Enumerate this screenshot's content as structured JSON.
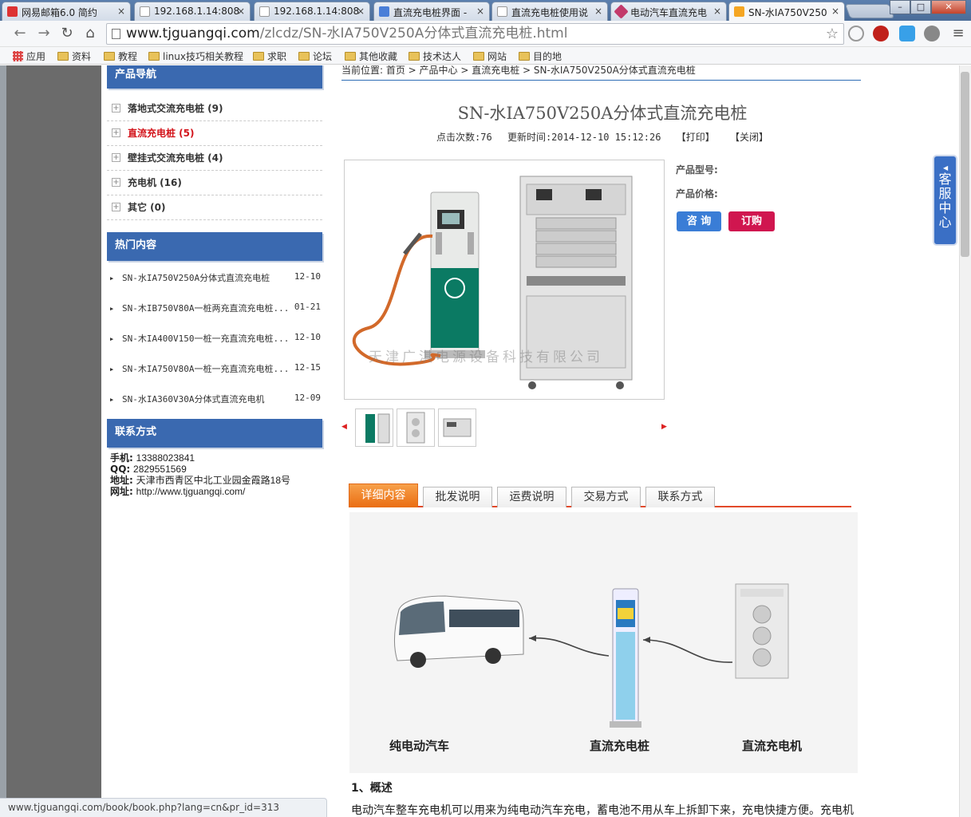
{
  "browser": {
    "tabs": [
      {
        "label": "网易邮箱6.0 简约",
        "icon_color": "#d33"
      },
      {
        "label": "192.168.1.14:808",
        "icon_color": "#ccc"
      },
      {
        "label": "192.168.1.14:808",
        "icon_color": "#ccc"
      },
      {
        "label": "直流充电桩界面 -",
        "icon_color": "#4a7fd8"
      },
      {
        "label": "直流充电桩使用说",
        "icon_color": "#ccc"
      },
      {
        "label": "电动汽车直流充电",
        "icon_color": "#c23a6b"
      },
      {
        "label": "SN-水IA750V250",
        "icon_color": "#f5a623"
      }
    ],
    "close_glyph": "×",
    "window_controls": {
      "minimize": "–",
      "maximize": "□",
      "close": "✕"
    },
    "url_host": "www.tjguangqi.com",
    "url_path": "/zlcdz/SN-水IA750V250A分体式直流充电桩.html",
    "bookmarks": [
      "应用",
      "资料",
      "教程",
      "linux技巧相关教程",
      "求职",
      "论坛",
      "其他收藏",
      "技术达人",
      "网站",
      "目的地"
    ],
    "status_url": "www.tjguangqi.com/book/book.php?lang=cn&pr_id=313"
  },
  "sidebar": {
    "nav_title": "产品导航",
    "nav_items": [
      {
        "label": "落地式交流充电桩 (9)",
        "active": false
      },
      {
        "label": "直流充电桩 (5)",
        "active": true
      },
      {
        "label": "壁挂式交流充电桩 (4)",
        "active": false
      },
      {
        "label": "充电机 (16)",
        "active": false
      },
      {
        "label": "其它 (0)",
        "active": false
      }
    ],
    "hot_title": "热门内容",
    "hot_items": [
      {
        "title": "SN-水IA750V250A分体式直流充电桩",
        "date": "12-10"
      },
      {
        "title": "SN-木IB750V80A一桩两充直流充电桩...",
        "date": "01-21"
      },
      {
        "title": "SN-木IA400V150一桩一充直流充电桩...",
        "date": "12-10"
      },
      {
        "title": "SN-木IA750V80A一桩一充直流充电桩...",
        "date": "12-15"
      },
      {
        "title": "SN-水IA360V30A分体式直流充电机",
        "date": "12-09"
      }
    ],
    "contact_title": "联系方式",
    "contact": {
      "phone_label": "手机:",
      "phone": "13388023841",
      "qq_label": "QQ:",
      "qq": "2829551569",
      "addr_label": "地址:",
      "addr": "天津市西青区中北工业园金霞路18号",
      "site_label": "网址:",
      "site": "http://www.tjguangqi.com/"
    }
  },
  "main": {
    "breadcrumb": "当前位置: 首页 > 产品中心 > 直流充电桩 > SN-水IA750V250A分体式直流充电桩",
    "title": "SN-水IA750V250A分体式直流充电桩",
    "clicks": "点击次数:76",
    "updated": "更新时间:2014-12-10 15:12:26",
    "print": "【打印】",
    "close": "【关闭】",
    "watermark": "天津广淇电源设备科技有限公司",
    "model_label": "产品型号:",
    "price_label": "产品价格:",
    "consult_btn": "咨 询",
    "order_btn": "订购",
    "tabs": [
      "详细内容",
      "批发说明",
      "运费说明",
      "交易方式",
      "联系方式"
    ],
    "diagram_labels": [
      "纯电动汽车",
      "直流充电桩",
      "直流充电机"
    ],
    "section_title": "1、概述",
    "paragraph": "电动汽车整车充电机可以用来为纯电动汽车充电，蓄电池不用从车上拆卸下来，充电快捷方便。充电机"
  },
  "service": {
    "label": "客服中心"
  }
}
